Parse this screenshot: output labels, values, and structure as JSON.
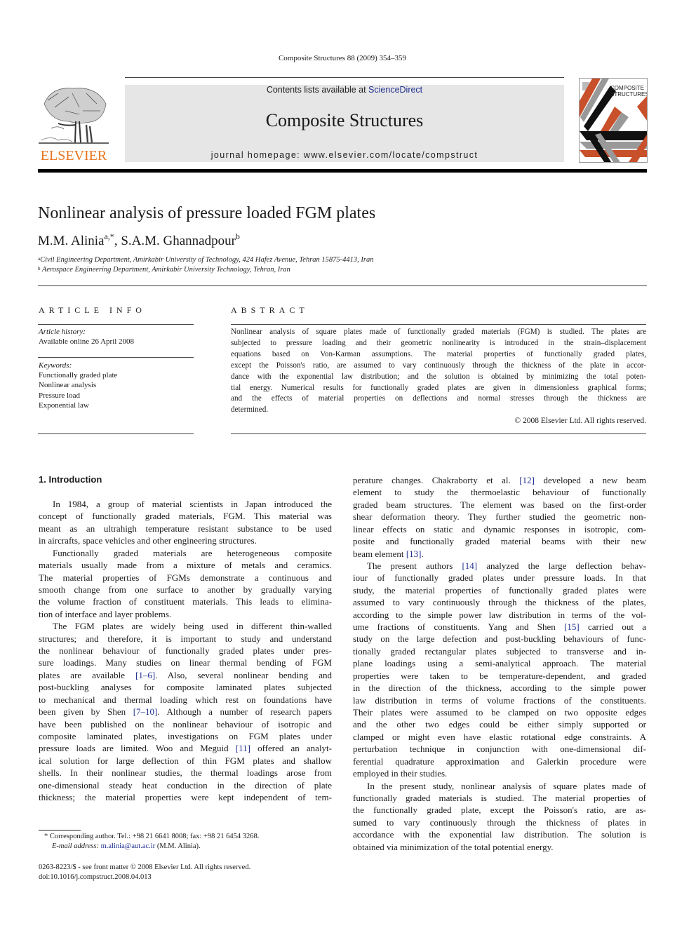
{
  "header": {
    "citation": "Composite Structures 88 (2009) 354–359",
    "contents_prefix": "Contents lists available at ",
    "contents_link": "ScienceDirect",
    "journal_name": "Composite Structures",
    "homepage": "journal homepage: www.elsevier.com/locate/compstruct",
    "publisher_logo_text": "ELSEVIER",
    "cover_title_line1": "COMPOSITE",
    "cover_title_line2": "STRUCTURES",
    "colors": {
      "publisher_orange": "#e8761e",
      "link_blue": "#1f2f8f",
      "cover_orange": "#c8502a",
      "banner_gray": "#e6e6e6"
    }
  },
  "article": {
    "title": "Nonlinear analysis of pressure loaded FGM plates",
    "authors": [
      {
        "name": "M.M. Alinia",
        "marks": "a,*"
      },
      {
        "name": "S.A.M. Ghannadpour",
        "marks": "b"
      }
    ],
    "author_separator": ", ",
    "affiliations": [
      {
        "mark": "a",
        "text": "Civil Engineering Department, Amirkabir University of Technology, 424 Hafez Avenue, Tehran 15875-4413, Iran"
      },
      {
        "mark": "b",
        "text": " Aerospace Engineering Department, Amirkabir University Technology, Tehran, Iran"
      }
    ]
  },
  "article_info": {
    "heading": "ARTICLE INFO",
    "history_label": "Article history:",
    "history_value": "Available online 26 April 2008",
    "keywords_label": "Keywords:",
    "keywords": [
      "Functionally graded plate",
      "Nonlinear analysis",
      "Pressure load",
      "Exponential law"
    ]
  },
  "abstract": {
    "heading": "ABSTRACT",
    "lines": [
      "Nonlinear analysis of square plates made of functionally graded materials (FGM) is studied. The plates are",
      "subjected to pressure loading and their geometric nonlinearity is introduced in the strain–displacement",
      "equations based on Von-Karman assumptions. The material properties of functionally graded plates,",
      "except the Poisson's ratio, are assumed to vary continuously through the thickness of the plate in accor-",
      "dance with the exponential law distribution; and the solution is obtained by minimizing the total poten-",
      "tial energy. Numerical results for functionally graded plates are given in dimensionless graphical forms;",
      "and the effects of material properties on deflections and normal stresses through the thickness are",
      "determined."
    ],
    "copyright": "© 2008 Elsevier Ltd. All rights reserved."
  },
  "body": {
    "section_heading": "1. Introduction",
    "left_column": [
      {
        "t": "In 1984, a group of material scientists in Japan introduced the",
        "indent": true
      },
      {
        "t": "concept of functionally graded materials, FGM. This material was"
      },
      {
        "t": "meant as an ultrahigh temperature resistant substance to be used"
      },
      {
        "t": "in aircrafts, space vehicles and other engineering structures.",
        "last": true
      },
      {
        "t": "Functionally graded materials are heterogeneous composite",
        "indent": true
      },
      {
        "t": "materials usually made from a mixture of metals and ceramics."
      },
      {
        "t": "The material properties of FGMs demonstrate a continuous and"
      },
      {
        "t": "smooth change from one surface to another by gradually varying"
      },
      {
        "t": "the volume fraction of constituent materials. This leads to elimina-"
      },
      {
        "t": "tion of interface and layer problems.",
        "last": true
      },
      {
        "t": "The FGM plates are widely being used in different thin-walled",
        "indent": true
      },
      {
        "t": "structures; and therefore, it is important to study and understand"
      },
      {
        "t": "the nonlinear behaviour of functionally graded plates under pres-"
      },
      {
        "t": "sure loadings. Many studies on linear thermal bending of FGM"
      },
      {
        "t": "plates are available ",
        "ref": "[1–6]",
        "after": ". Also, several nonlinear bending and"
      },
      {
        "t": "post-buckling analyses for composite laminated plates subjected"
      },
      {
        "t": "to mechanical and thermal loading which rest on foundations have"
      },
      {
        "t": "been given by Shen ",
        "ref": "[7–10]",
        "after": ". Although a number of research papers"
      },
      {
        "t": "have been published on the nonlinear behaviour of isotropic and"
      },
      {
        "t": "composite laminated plates, investigations on FGM plates under"
      },
      {
        "t": "pressure loads are limited. Woo and Meguid ",
        "ref": "[11]",
        "after": " offered an analyt-"
      },
      {
        "t": "ical solution for large deflection of thin FGM plates and shallow"
      },
      {
        "t": "shells. In their nonlinear studies, the thermal loadings arose from"
      },
      {
        "t": "one-dimensional steady heat conduction in the direction of plate"
      },
      {
        "t": "thickness; the material properties were kept independent of tem-"
      }
    ],
    "right_column": [
      {
        "t": "perature changes. Chakraborty et al. ",
        "ref": "[12]",
        "after": " developed a new beam"
      },
      {
        "t": "element to study the thermoelastic behaviour of functionally"
      },
      {
        "t": "graded beam structures. The element was based on the first-order"
      },
      {
        "t": "shear deformation theory. They further studied the geometric non-"
      },
      {
        "t": "linear effects on static and dynamic responses in isotropic, com-"
      },
      {
        "t": "posite and functionally graded material beams with their new"
      },
      {
        "t": "beam element ",
        "ref": "[13]",
        "after": ".",
        "last": true
      },
      {
        "t": "The present authors ",
        "ref": "[14]",
        "after": " analyzed the large deflection behav-",
        "indent": true
      },
      {
        "t": "iour of functionally graded plates under pressure loads. In that"
      },
      {
        "t": "study, the material properties of functionally graded plates were"
      },
      {
        "t": "assumed to vary continuously through the thickness of the plates,"
      },
      {
        "t": "according to the simple power law distribution in terms of the vol-"
      },
      {
        "t": "ume fractions of constituents. Yang and Shen ",
        "ref": "[15]",
        "after": " carried out a"
      },
      {
        "t": "study on the large defection and post-buckling behaviours of func-"
      },
      {
        "t": "tionally graded rectangular plates subjected to transverse and in-"
      },
      {
        "t": "plane loadings using a semi-analytical approach. The material"
      },
      {
        "t": "properties were taken to be temperature-dependent, and graded"
      },
      {
        "t": "in the direction of the thickness, according to the simple power"
      },
      {
        "t": "law distribution in terms of volume fractions of the constituents."
      },
      {
        "t": "Their plates were assumed to be clamped on two opposite edges"
      },
      {
        "t": "and the other two edges could be either simply supported or"
      },
      {
        "t": "clamped or might even have elastic rotational edge constraints. A"
      },
      {
        "t": "perturbation technique in conjunction with one-dimensional dif-"
      },
      {
        "t": "ferential quadrature approximation and Galerkin procedure were"
      },
      {
        "t": "employed in their studies.",
        "last": true
      },
      {
        "t": "In the present study, nonlinear analysis of square plates made of",
        "indent": true
      },
      {
        "t": "functionally graded materials is studied. The material properties of"
      },
      {
        "t": "the functionally graded plate, except the Poisson's ratio, are as-"
      },
      {
        "t": "sumed to vary continuously through the thickness of plates in"
      },
      {
        "t": "accordance with the exponential law distribution. The solution is"
      },
      {
        "t": "obtained via minimization of the total potential energy.",
        "last": true
      }
    ]
  },
  "footnote": {
    "corresponding": "* Corresponding author. Tel.: +98 21 6641 8008; fax: +98 21 6454 3268.",
    "email_label": "E-mail address: ",
    "email": "m.alinia@aut.ac.ir",
    "email_owner": " (M.M. Alinia).",
    "front_matter": "0263-8223/$ - see front matter © 2008 Elsevier Ltd. All rights reserved.",
    "doi": "doi:10.1016/j.compstruct.2008.04.013"
  }
}
